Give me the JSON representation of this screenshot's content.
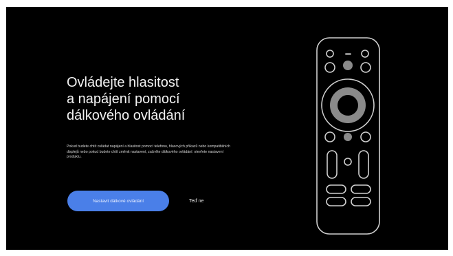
{
  "colors": {
    "background": "#000000",
    "frame": "#ffffff",
    "title_text": "#f2f2f2",
    "body_text": "#d9d9d9",
    "primary_button": "#4a7fe8",
    "remote_outline": "#cfcfcf",
    "remote_fill": "#8a8a8a"
  },
  "setup": {
    "title_lines": [
      "Ovládejte hlasitost",
      "a napájení pomocí",
      "dálkového ovládání"
    ],
    "description": "Pokud budete chtít ovládat napájení a hlasitost pomocí telefonu, hlasových příkazů nebo kompatibilních displejů nebo pokud budete chtít změnit nastavení, začněte dálkového ovládání: otevřete nastavení produktu.",
    "primary_button_label": "Nastavit dálkové ovládání",
    "secondary_button_label": "Teď ne"
  },
  "illustration": {
    "icon": "remote-control-icon"
  }
}
